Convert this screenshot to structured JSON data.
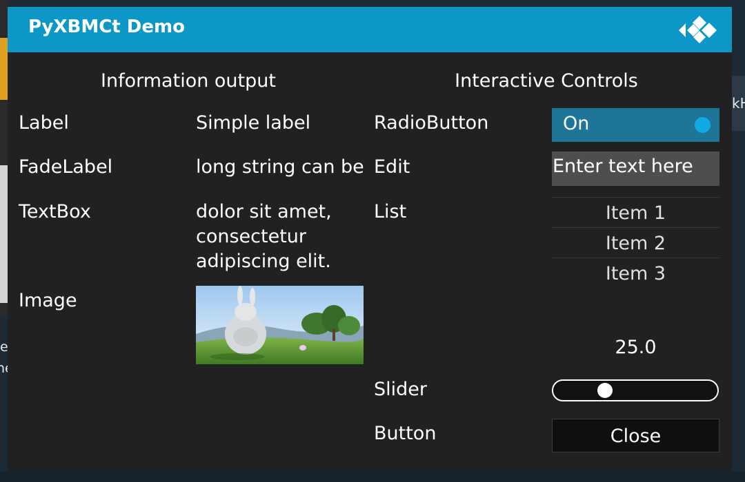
{
  "background": {
    "right_text": "kH",
    "left_text_1": "e",
    "left_text_2": "he"
  },
  "dialog": {
    "title": "PyXBMCt Demo",
    "logo_icon": "kodi-logo-icon"
  },
  "info_section": {
    "heading": "Information output",
    "rows": {
      "label": {
        "name": "Label",
        "value": "Simple label"
      },
      "fadelabel": {
        "name": "FadeLabel",
        "value": "long string can be"
      },
      "textbox": {
        "name": "TextBox",
        "lines": [
          "dolor sit amet,",
          "consectetur",
          "adipiscing elit."
        ]
      },
      "image": {
        "name": "Image"
      }
    }
  },
  "controls_section": {
    "heading": "Interactive Controls",
    "radio": {
      "name": "RadioButton",
      "state_label": "On"
    },
    "edit": {
      "name": "Edit",
      "value": "Enter text here"
    },
    "list": {
      "name": "List",
      "items": [
        "Item 1",
        "Item 2",
        "Item 3"
      ]
    },
    "slider": {
      "name": "Slider",
      "value_text": "25.0",
      "value": 25,
      "max": 100
    },
    "button": {
      "name": "Button",
      "label": "Close"
    }
  },
  "colors": {
    "title_bar": "#0c97c6",
    "dialog_bg": "#212121",
    "radio_bg": "#1d7598",
    "radio_dot": "#13a9e2",
    "edit_bg": "#4e4e4e"
  }
}
